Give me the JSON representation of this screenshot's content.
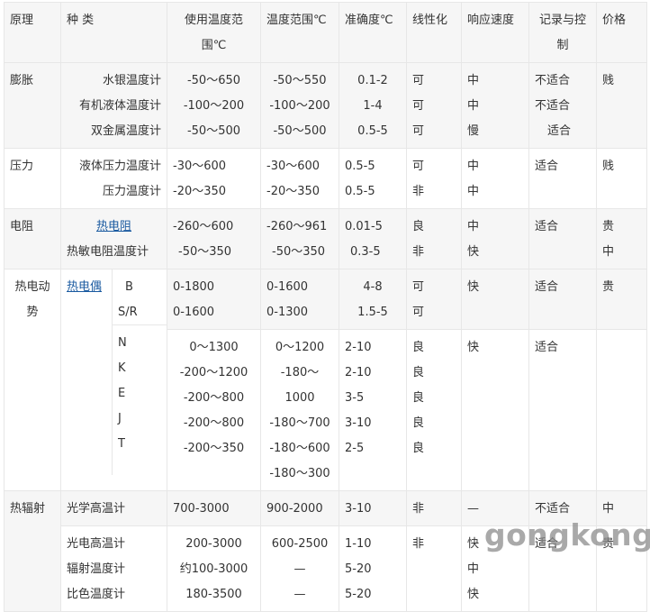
{
  "headers": [
    "原理",
    "种 类",
    "使用温度范围℃",
    "温度范围℃",
    "准确度℃",
    "线性化",
    "响应速度",
    "记录与控制",
    "价格"
  ],
  "header_lines": {
    "use_range": [
      "使用温度范",
      "围℃"
    ],
    "record": [
      "记录与控",
      "制"
    ]
  },
  "rows": [
    {
      "principle": "膨胀",
      "types": [
        "水银温度计",
        "有机液体温度计",
        "双金属温度计"
      ],
      "use_range": [
        "-50～650",
        "-100～200",
        "-50～500"
      ],
      "temp_range": [
        "-50～550",
        "-100～200",
        "-50～500"
      ],
      "accuracy": [
        "0.1-2",
        "1-4",
        "0.5-5"
      ],
      "linear": [
        "可",
        "可",
        "可"
      ],
      "speed": [
        "中",
        "中",
        "慢"
      ],
      "record": [
        "不适合",
        "不适合",
        "适合"
      ],
      "price": "贱"
    },
    {
      "principle": "压力",
      "types": [
        "液体压力温度计",
        "压力温度计"
      ],
      "use_range": [
        "-30～600",
        "-20～350"
      ],
      "temp_range": [
        "-30～600",
        "-20～350"
      ],
      "accuracy": [
        "0.5-5",
        "0.5-5"
      ],
      "linear": [
        "可",
        "非"
      ],
      "speed": [
        "中",
        "中"
      ],
      "record": [
        "适合"
      ],
      "price": "贱"
    },
    {
      "principle": "电阻",
      "types": [
        "热电阻",
        "热敏电阻温度计"
      ],
      "use_range": [
        "-260～600",
        "-50～350"
      ],
      "temp_range": [
        "-260～961",
        "-50～350"
      ],
      "accuracy": [
        "0.01-5",
        "0.3-5"
      ],
      "linear": [
        "良",
        "非"
      ],
      "speed": [
        "中",
        "快"
      ],
      "record": [
        "适合"
      ],
      "price": [
        "贵",
        "中"
      ]
    }
  ],
  "thermo": {
    "principle": [
      "热电动",
      "势"
    ],
    "type_link": "热电偶",
    "group1": {
      "codes": [
        "B",
        "S/R"
      ],
      "use_range": [
        "0-1800",
        "0-1600"
      ],
      "temp_range": [
        "0-1600",
        "0-1300"
      ],
      "accuracy": [
        "4-8",
        "1.5-5"
      ],
      "linear": [
        "可",
        "可"
      ],
      "speed": "快",
      "record": "适合",
      "price": "贵"
    },
    "group2": {
      "codes": [
        "N",
        "K",
        "E",
        "J",
        "T"
      ],
      "use_range": [
        "0～1300",
        "-200～1200",
        "-200～800",
        "-200～800",
        "-200～350"
      ],
      "temp_range": [
        "0～1200",
        "-180～",
        "1000",
        "-180～700",
        "-180～600",
        "-180～300"
      ],
      "accuracy": [
        "2-10",
        "2-10",
        "3-5",
        "3-10",
        "2-5"
      ],
      "linear": [
        "良",
        "良",
        "良",
        "良",
        "良"
      ],
      "speed": "快",
      "record": "适合"
    }
  },
  "radiation": {
    "principle": "热辐射",
    "row1": {
      "type": "光学高温计",
      "use_range": "700-3000",
      "temp_range": "900-2000",
      "accuracy": "3-10",
      "linear": "非",
      "speed": "—",
      "record": "不适合",
      "price": "中"
    },
    "row2": {
      "types": [
        "光电高温计",
        "辐射温度计",
        "比色温度计"
      ],
      "use_range": [
        "200-3000",
        "约100-3000",
        "180-3500"
      ],
      "temp_range": [
        "600-2500",
        "—",
        "—"
      ],
      "accuracy": [
        "1-10",
        "5-20",
        "5-20"
      ],
      "linear": "非",
      "speed": [
        "快",
        "中",
        "快"
      ],
      "record": "适合",
      "price": "贵"
    }
  },
  "watermark": "gongkong"
}
